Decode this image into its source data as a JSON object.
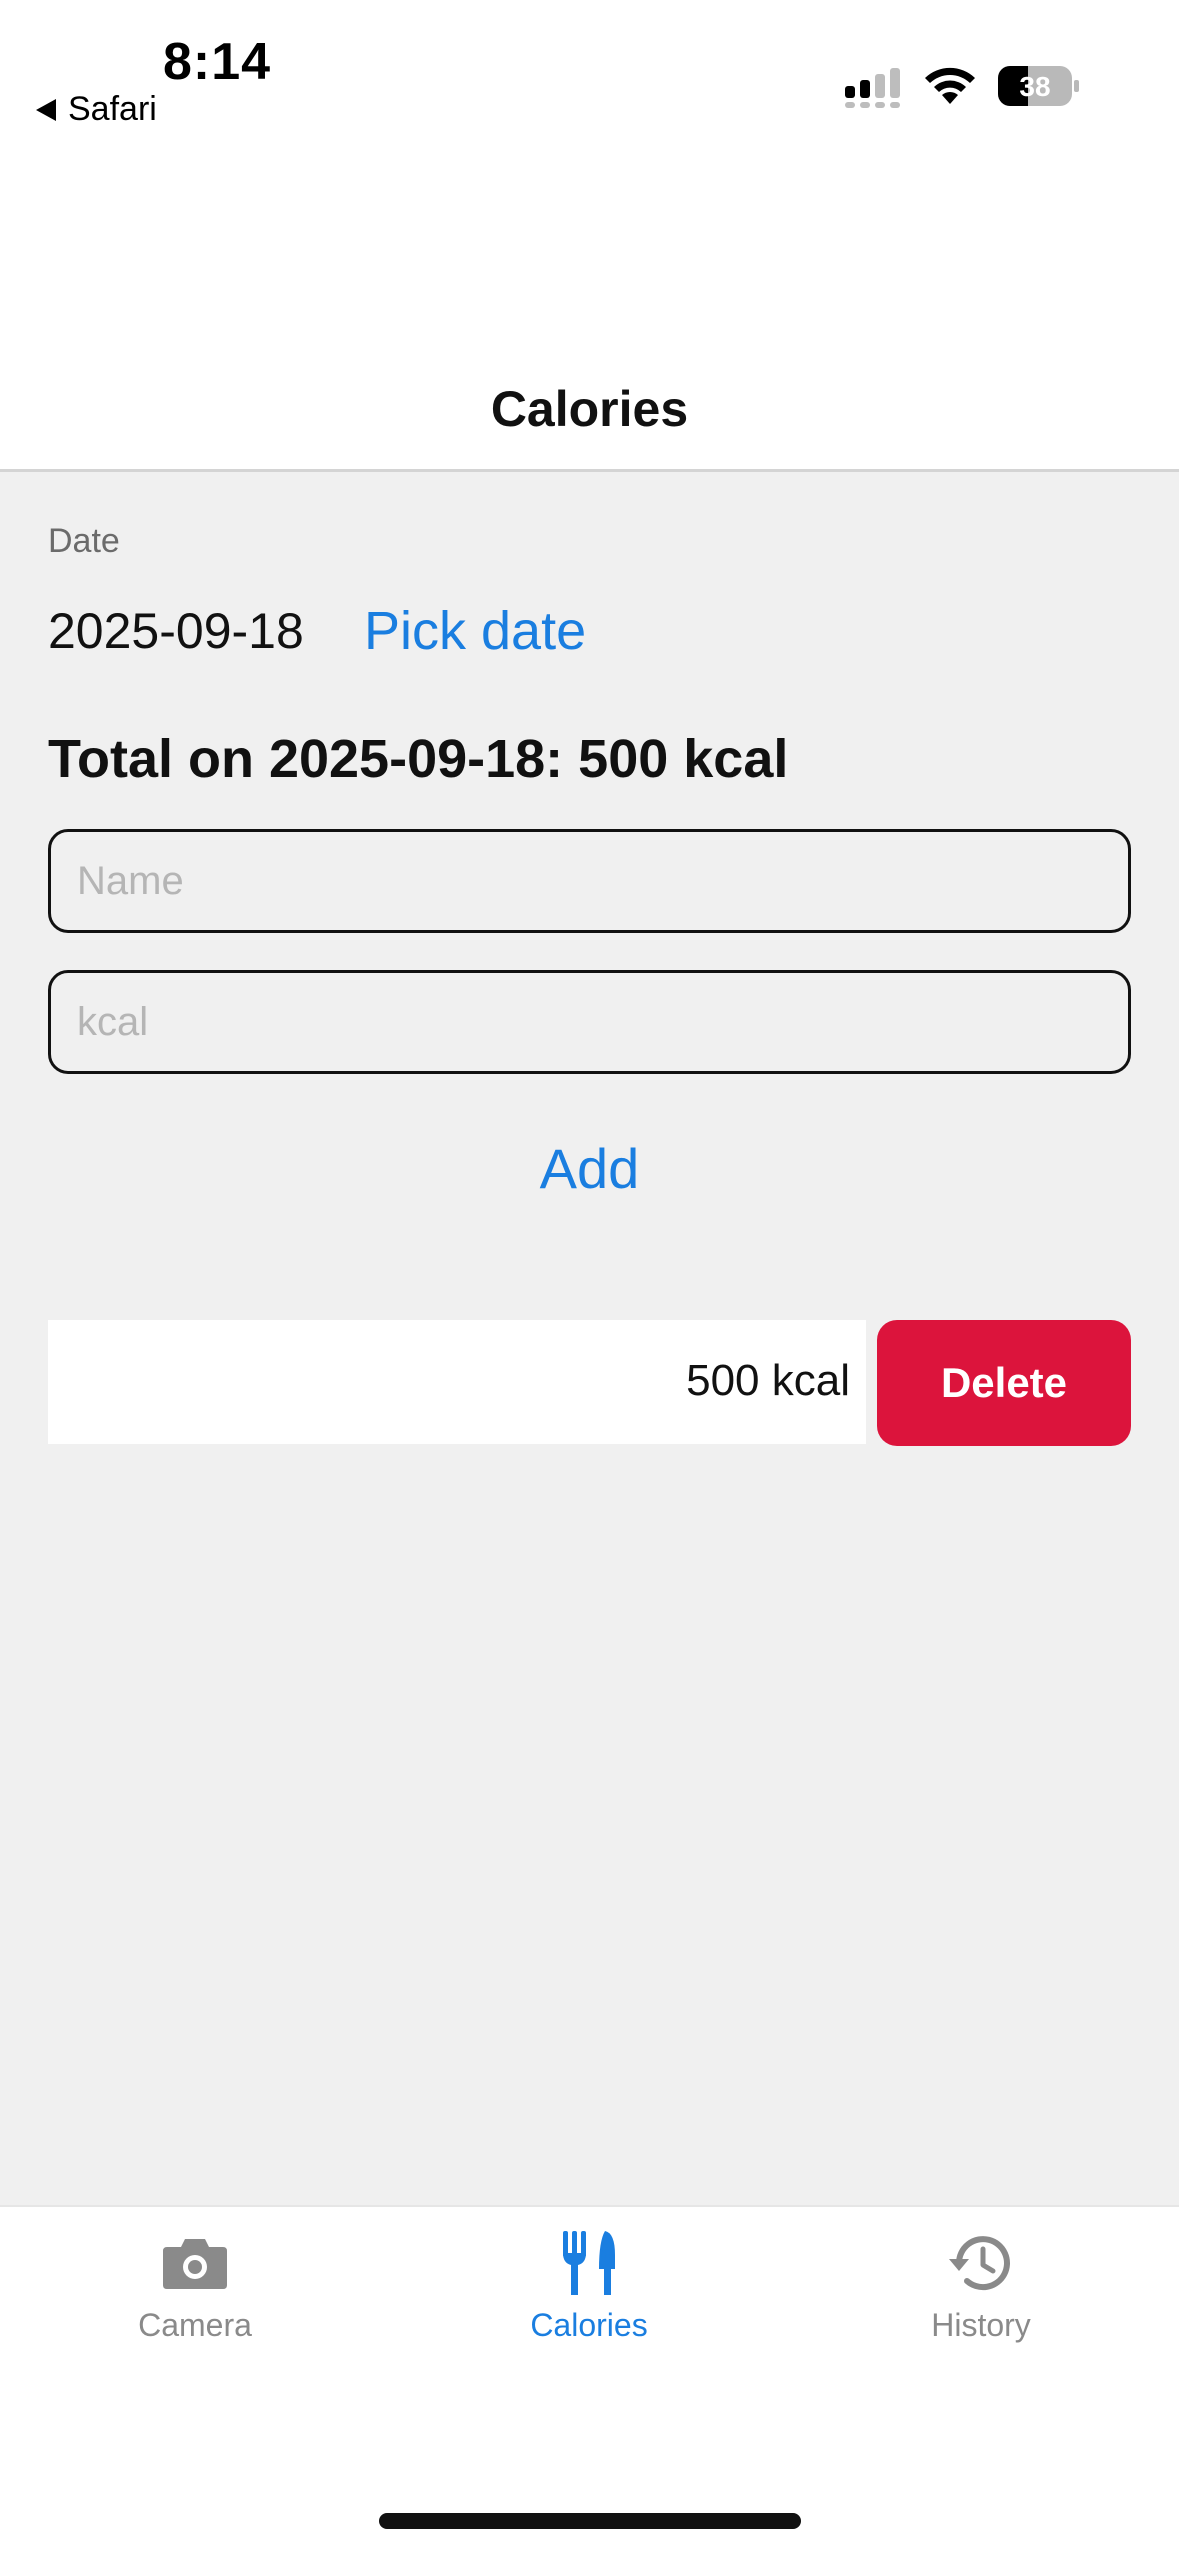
{
  "status_bar": {
    "time": "8:14",
    "back_app": "Safari",
    "battery_level": "38"
  },
  "nav": {
    "title": "Calories"
  },
  "form": {
    "date_label": "Date",
    "date_value": "2025-09-18",
    "pick_date_label": "Pick date",
    "total_text": "Total on 2025-09-18: 500 kcal",
    "name_placeholder": "Name",
    "kcal_placeholder": "kcal",
    "add_label": "Add"
  },
  "entries": [
    {
      "kcal": "500 kcal",
      "delete_label": "Delete"
    }
  ],
  "tab_bar": {
    "tabs": [
      {
        "label": "Camera",
        "icon": "camera-icon"
      },
      {
        "label": "Calories",
        "icon": "fork-knife-icon",
        "active": true
      },
      {
        "label": "History",
        "icon": "history-icon"
      }
    ]
  },
  "colors": {
    "accent": "#1a7ee0",
    "delete": "#dc143c",
    "background": "#f0f0f0"
  }
}
